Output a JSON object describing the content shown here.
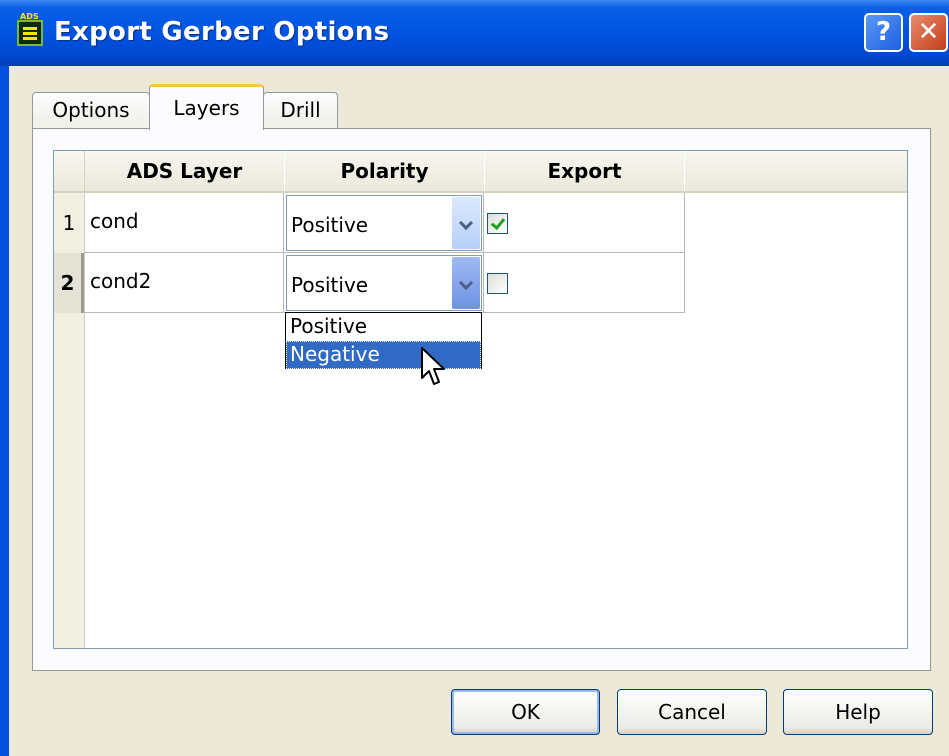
{
  "window": {
    "title": "Export Gerber Options",
    "help_glyph": "?",
    "close_glyph": "✕"
  },
  "tabs": [
    {
      "label": "Options"
    },
    {
      "label": "Layers"
    },
    {
      "label": "Drill"
    }
  ],
  "active_tab": "Layers",
  "table": {
    "headers": [
      "ADS Layer",
      "Polarity",
      "Export"
    ],
    "rows": [
      {
        "num": "1",
        "layer": "cond",
        "polarity": "Positive",
        "export": true
      },
      {
        "num": "2",
        "layer": "cond2",
        "polarity": "Positive",
        "export": false
      }
    ]
  },
  "polarity_dropdown": {
    "options": [
      "Positive",
      "Negative"
    ],
    "highlighted": "Negative"
  },
  "buttons": {
    "ok": "OK",
    "cancel": "Cancel",
    "help": "Help"
  },
  "colors": {
    "titlebar": "#0054e3",
    "dialog_bg": "#ece9d8",
    "selection": "#316ac5",
    "active_tab_accent": "#ffc83c"
  }
}
